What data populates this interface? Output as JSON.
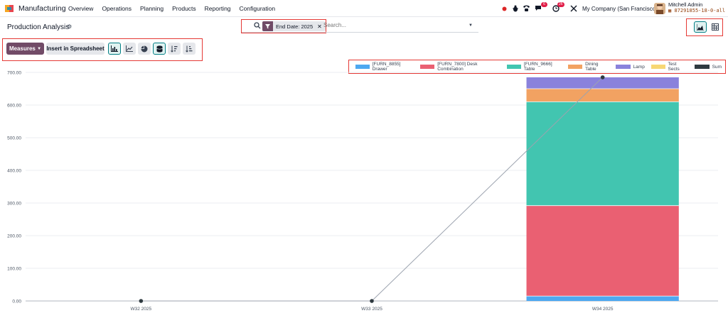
{
  "navbar": {
    "app_name": "Manufacturing",
    "menu": [
      "Overview",
      "Operations",
      "Planning",
      "Products",
      "Reporting",
      "Configuration"
    ],
    "messages_badge": "6",
    "activities_badge": "26",
    "company": "My Company (San Francisco)",
    "user_name": "Mitchell Admin",
    "db_name": "87291855-18-0-all"
  },
  "control_panel": {
    "title": "Production Analysis",
    "facet_label": "End Date: 2025",
    "search_placeholder": "Search..."
  },
  "toolbar": {
    "measures_label": "Measures",
    "insert_label": "Insert in Spreadsheet"
  },
  "colors": {
    "accent": "#714b67",
    "active": "#017e84"
  },
  "chart_data": {
    "type": "bar",
    "stacked": true,
    "categories": [
      "W32 2025",
      "W33 2025",
      "W34 2025"
    ],
    "ylim": [
      0,
      700
    ],
    "yticks": [
      "0.00",
      "100.00",
      "200.00",
      "300.00",
      "400.00",
      "500.00",
      "600.00",
      "700.00"
    ],
    "grid": true,
    "legend_position": "top-right",
    "series": [
      {
        "name": "[FURN_8855] Drawer",
        "color": "#4ea8f0",
        "values": [
          0,
          0,
          15
        ]
      },
      {
        "name": "[FURN_7800] Desk Combination",
        "color": "#ea6072",
        "values": [
          0,
          0,
          277
        ]
      },
      {
        "name": "[FURN_9666] Table",
        "color": "#42c5b0",
        "values": [
          0,
          0,
          318
        ]
      },
      {
        "name": "Dining Table",
        "color": "#f2a262",
        "values": [
          0,
          0,
          40
        ]
      },
      {
        "name": "Lamp",
        "color": "#8a82dc",
        "values": [
          0,
          0,
          35
        ]
      },
      {
        "name": "Test Sects",
        "color": "#f7d774",
        "values": [
          0,
          0,
          0
        ]
      }
    ],
    "line": {
      "name": "Sum",
      "color": "#2f3a40",
      "values": [
        0,
        0,
        685
      ]
    }
  }
}
